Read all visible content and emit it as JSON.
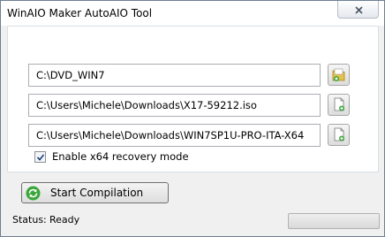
{
  "window": {
    "title": "WinAIO Maker AutoAIO Tool"
  },
  "fields": [
    {
      "value": "C:\\DVD_WIN7",
      "browse_icon": "folder-open-icon"
    },
    {
      "value": "C:\\Users\\Michele\\Downloads\\X17-59212.iso",
      "browse_icon": "add-file-icon"
    },
    {
      "value": "C:\\Users\\Michele\\Downloads\\WIN7SP1U-PRO-ITA-X64",
      "browse_icon": "add-file-icon"
    }
  ],
  "options": {
    "x64_recovery_label": "Enable x64 recovery mode",
    "x64_recovery_checked": true
  },
  "actions": {
    "start_label": "Start Compilation",
    "start_icon": "refresh-icon"
  },
  "status": {
    "label": "Status:",
    "value": "Ready",
    "progress": 0
  },
  "colors": {
    "accent_green": "#3aa63a",
    "folder_yellow": "#e6c24a"
  }
}
